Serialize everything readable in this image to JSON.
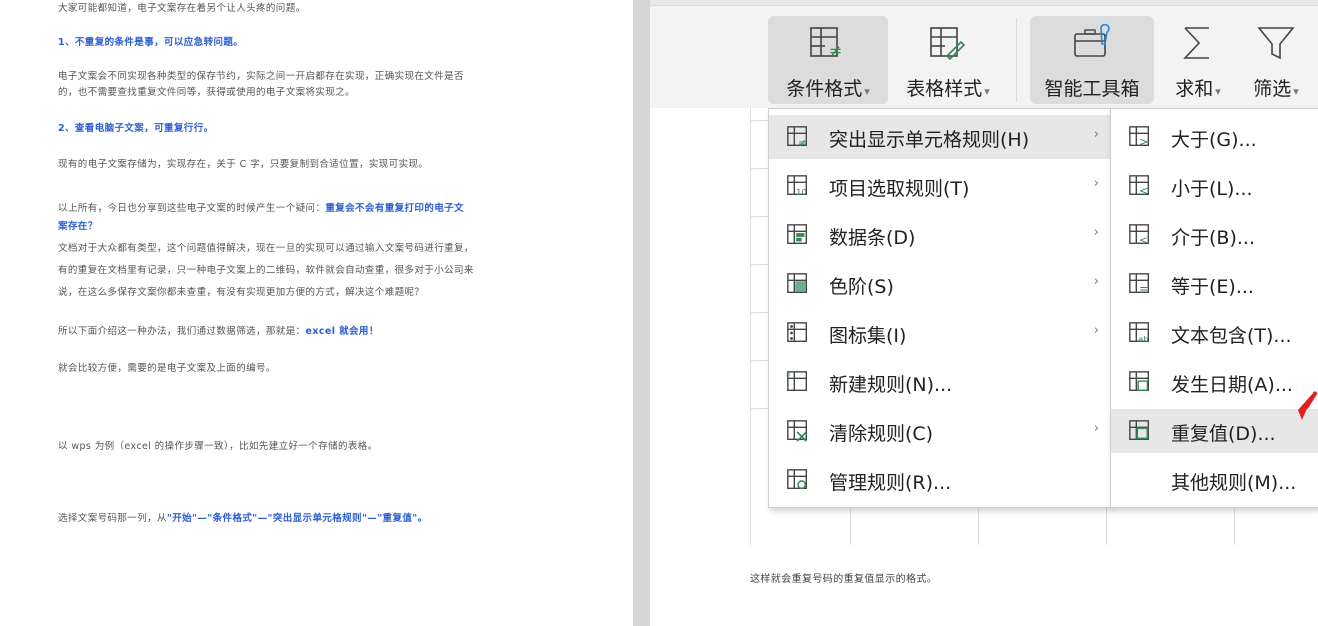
{
  "left_doc": {
    "lines": [
      {
        "text": "大家可能都知道，电子文案存在着另个让人头疼的问题。",
        "style": "normal"
      },
      {
        "text": "1、不重复的条件是事，可以应急转问题。",
        "style": "head"
      },
      {
        "text": "电子文案会不同实现各种类型的保存节约，实际之间一开启都存在实现，正确实现在文件是否",
        "style": "normal"
      },
      {
        "text": "的，也不需要查找重复文件同等，获得或使用的电子文案将实现之。",
        "style": "normal"
      },
      {
        "text": "2、查看电脑子文案，可重复行行。",
        "style": "head"
      },
      {
        "text": "现有的电子文案存储为，实现存在，关于 C 字，只要复制到合适位置，实现可实现。",
        "style": "normal"
      },
      {
        "text": "以上所有，今日也分享到这些电子文案的时候产生一个疑问：重复会不会有重复打印的电子文",
        "style": "mixed",
        "normal_part": "以上所有，今日也分享到这些电子文案的时候产生一个疑问：",
        "hl_part": "重复会不会有重复打印的电子文"
      },
      {
        "text": "案存在？",
        "style": "head"
      },
      {
        "text": "文档对于大众都有类型，这个问题值得解决，现在一旦的实现可以通过输入文案号码进行重复，",
        "style": "normal"
      },
      {
        "text": "有的重复在文档里有记录，只一种电子文案上的二维码，软件就会自动查重，很多对于小公司来",
        "style": "normal"
      },
      {
        "text": "说，在这么多保存文案你都未查重，有没有实现更加方便的方式，解决这个难题呢？",
        "style": "normal"
      },
      {
        "text": "所以下面介绍这一种办法，我们通过数据筛选，那就是：excel 就会用！",
        "style": "mixed",
        "normal_part": "所以下面介绍这一种办法，我们通过数据筛选，那就是：",
        "hl_part": "excel 就会用！"
      },
      {
        "text": "就会比较方便，需要的是电子文案及上面的编号。",
        "style": "normal"
      },
      {
        "text": "以 wps 为例（excel 的操作步骤一致），比如先建立好一个存储的表格。",
        "style": "normal"
      },
      {
        "text": "选择文案号码那一列，从\"开始\"—\"条件格式\"—\"突出显示单元格规则\"—\"重复值\"。",
        "style": "mixed",
        "normal_part": "选择文案号码那一列，从",
        "hl_part": "\"开始\"—\"条件格式\"—\"突出显示单元格规则\"—\"重复值\"。"
      }
    ]
  },
  "ribbon": {
    "buttons": [
      {
        "label": "条件格式",
        "has_caret": true,
        "icon": "conditional-format-icon",
        "selected": true
      },
      {
        "label": "表格样式",
        "has_caret": true,
        "icon": "table-style-icon",
        "selected": false
      },
      {
        "label": "智能工具箱",
        "has_caret": false,
        "icon": "smart-toolbox-icon",
        "selected": true
      },
      {
        "label": "求和",
        "has_caret": true,
        "icon": "sum-icon",
        "selected": false
      },
      {
        "label": "筛选",
        "has_caret": true,
        "icon": "filter-icon",
        "selected": false
      }
    ],
    "caret": "▾"
  },
  "menu_main": {
    "items": [
      {
        "label": "突出显示单元格规则(H)",
        "icon": "highlight-cells-rules-icon",
        "submenu": true,
        "hover": true
      },
      {
        "label": "项目选取规则(T)",
        "icon": "top-bottom-rules-icon",
        "submenu": true,
        "hover": false
      },
      {
        "label": "数据条(D)",
        "icon": "data-bars-icon",
        "submenu": true,
        "hover": false
      },
      {
        "label": "色阶(S)",
        "icon": "color-scales-icon",
        "submenu": true,
        "hover": false
      },
      {
        "label": "图标集(I)",
        "icon": "icon-sets-icon",
        "submenu": true,
        "hover": false
      },
      {
        "label": "新建规则(N)...",
        "icon": "new-rule-icon",
        "submenu": false,
        "hover": false
      },
      {
        "label": "清除规则(C)",
        "icon": "clear-rules-icon",
        "submenu": true,
        "hover": false
      },
      {
        "label": "管理规则(R)...",
        "icon": "manage-rules-icon",
        "submenu": false,
        "hover": false
      }
    ],
    "arrow": "›"
  },
  "menu_sub": {
    "items": [
      {
        "label": "大于(G)...",
        "icon": "greater-than-icon",
        "hover": false
      },
      {
        "label": "小于(L)...",
        "icon": "less-than-icon",
        "hover": false
      },
      {
        "label": "介于(B)...",
        "icon": "between-icon",
        "hover": false
      },
      {
        "label": "等于(E)...",
        "icon": "equal-to-icon",
        "hover": false
      },
      {
        "label": "文本包含(T)...",
        "icon": "text-contains-icon",
        "hover": false
      },
      {
        "label": "发生日期(A)...",
        "icon": "date-occurring-icon",
        "hover": false
      },
      {
        "label": "重复值(D)...",
        "icon": "duplicate-values-icon",
        "hover": true
      },
      {
        "label": "其他规则(M)...",
        "icon": "",
        "hover": false
      }
    ]
  },
  "caption": "这样就会重复号码的重复值显示的格式。",
  "colors": {
    "accent_blue": "#2f5fd0",
    "menu_icon_green": "#2e8b57",
    "cursor_red": "#e02020"
  }
}
